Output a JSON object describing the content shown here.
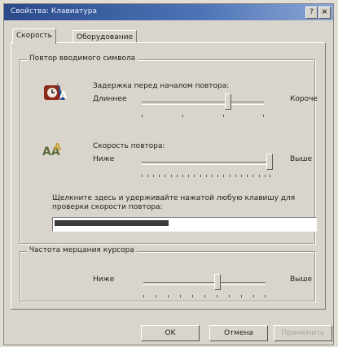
{
  "window": {
    "title": "Свойства: Клавиатура",
    "help_label": "?",
    "close_label": "×"
  },
  "tabs": [
    {
      "label": "Скорость"
    },
    {
      "label": "Оборудование"
    }
  ],
  "char_repeat": {
    "group_title": "Повтор вводимого символа",
    "delay": {
      "label": "Задержка перед началом повтора:",
      "min_label": "Длиннее",
      "max_label": "Короче",
      "value": 0.75
    },
    "rate": {
      "label": "Скорость повтора:",
      "min_label": "Ниже",
      "max_label": "Выше",
      "value": 1.0
    },
    "test_hint": "Щелкните здесь и удерживайте нажатой любую клавишу для проверки скорости повтора:"
  },
  "cursor_blink": {
    "group_title": "Частота мерцания курсора",
    "min_label": "Ниже",
    "max_label": "Выше",
    "value": 0.6
  },
  "buttons": {
    "ok": "OK",
    "cancel": "Отмена",
    "apply": "Применить"
  }
}
